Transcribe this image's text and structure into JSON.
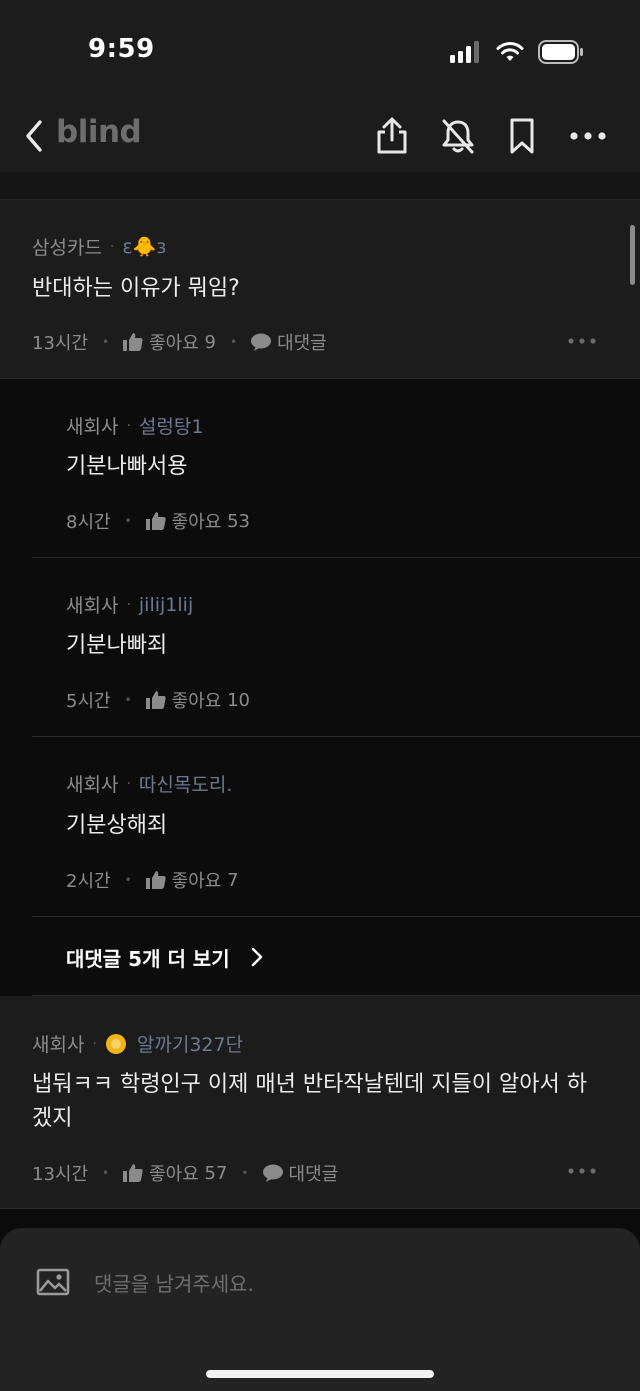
{
  "status": {
    "time": "9:59"
  },
  "nav": {
    "logo": "blind",
    "icons": [
      "back-chevron-icon",
      "share-icon",
      "bell-off-icon",
      "bookmark-icon",
      "more-icon"
    ]
  },
  "comments": [
    {
      "company": "삼성카드",
      "nickname": "ε🐥з",
      "text": "반대하는 이유가 뭐임?",
      "time": "13시간",
      "like_label": "좋아요",
      "likes": "9",
      "reply_label": "대댓글"
    }
  ],
  "replies": [
    {
      "company": "새회사",
      "nickname": "설렁탕1",
      "text": "기분나빠서용",
      "time": "8시간",
      "like_label": "좋아요",
      "likes": "53"
    },
    {
      "company": "새회사",
      "nickname": "jilij1lij",
      "text": "기분나빠죄",
      "time": "5시간",
      "like_label": "좋아요",
      "likes": "10"
    },
    {
      "company": "새회사",
      "nickname": "따신목도리.",
      "text": "기분상해죄",
      "time": "2시간",
      "like_label": "좋아요",
      "likes": "7"
    }
  ],
  "view_more": {
    "label": "대댓글 5개 더 보기"
  },
  "comment2": {
    "company": "새회사",
    "nickname": "알까기327단",
    "text_line1": "냅둬ㅋㅋ 학령인구 이제 매년 반타작날텐데 지들이 알아서 하",
    "text_line2": "겠지",
    "time": "13시간",
    "like_label": "좋아요",
    "likes": "57",
    "reply_label": "대댓글"
  },
  "composer": {
    "placeholder": "댓글을 남겨주세요."
  },
  "colors": {
    "background": "#0c0c0c",
    "card": "#1c1c1c",
    "nickname": "#6c7790"
  }
}
